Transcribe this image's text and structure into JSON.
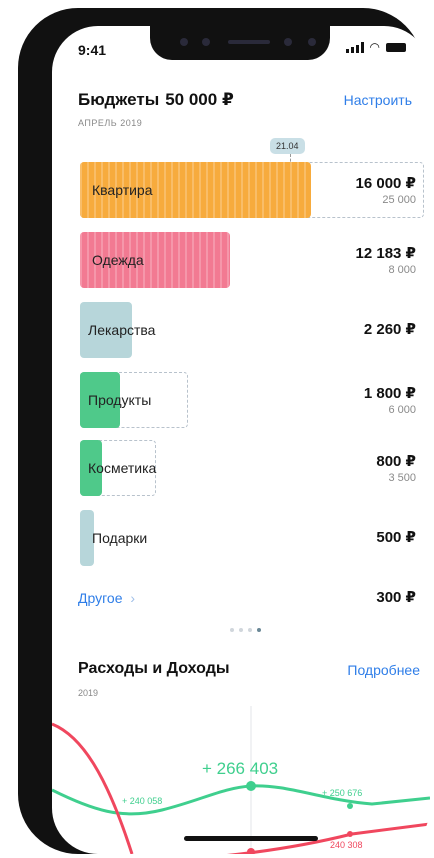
{
  "status_bar": {
    "time": "9:41"
  },
  "budgets": {
    "title": "Бюджеты",
    "total": "50 000 ₽",
    "configure_label": "Настроить",
    "period": "АПРЕЛЬ 2019",
    "today_marker": "21.04",
    "categories": [
      {
        "name": "Квартира",
        "spent": "16 000 ₽",
        "limit": "25 000",
        "color": "#f7ab3d",
        "fill_fraction": 0.64
      },
      {
        "name": "Одежда",
        "spent": "12 183 ₽",
        "limit": "8 000",
        "color": "#f27a92",
        "fill_fraction": 1.0
      },
      {
        "name": "Лекарства",
        "spent": "2 260 ₽",
        "limit": "",
        "color": "#b7d6da",
        "fill_fraction": 1.0
      },
      {
        "name": "Продукты",
        "spent": "1 800 ₽",
        "limit": "6 000",
        "color": "#4fc98a",
        "fill_fraction": 0.3
      },
      {
        "name": "Косметика",
        "spent": "800 ₽",
        "limit": "3 500",
        "color": "#4fc98a",
        "fill_fraction": 0.23
      },
      {
        "name": "Подарки",
        "spent": "500 ₽",
        "limit": "",
        "color": "#b7d6da",
        "fill_fraction": 1.0
      }
    ],
    "other_label": "Другое",
    "other_amount": "300 ₽"
  },
  "pager": {
    "pages": 4,
    "active": 3
  },
  "expenses_income": {
    "title": "Расходы и Доходы",
    "more_label": "Подробнее",
    "year": "2019",
    "center_value": "+ 266 403",
    "left_value": "+ 240 058",
    "right_value": "+ 250 676",
    "right_expense": "240 308",
    "colors": {
      "income": "#3fcf8e",
      "expense": "#f0475e"
    }
  },
  "colors": {
    "accent": "#2f7ee8"
  }
}
